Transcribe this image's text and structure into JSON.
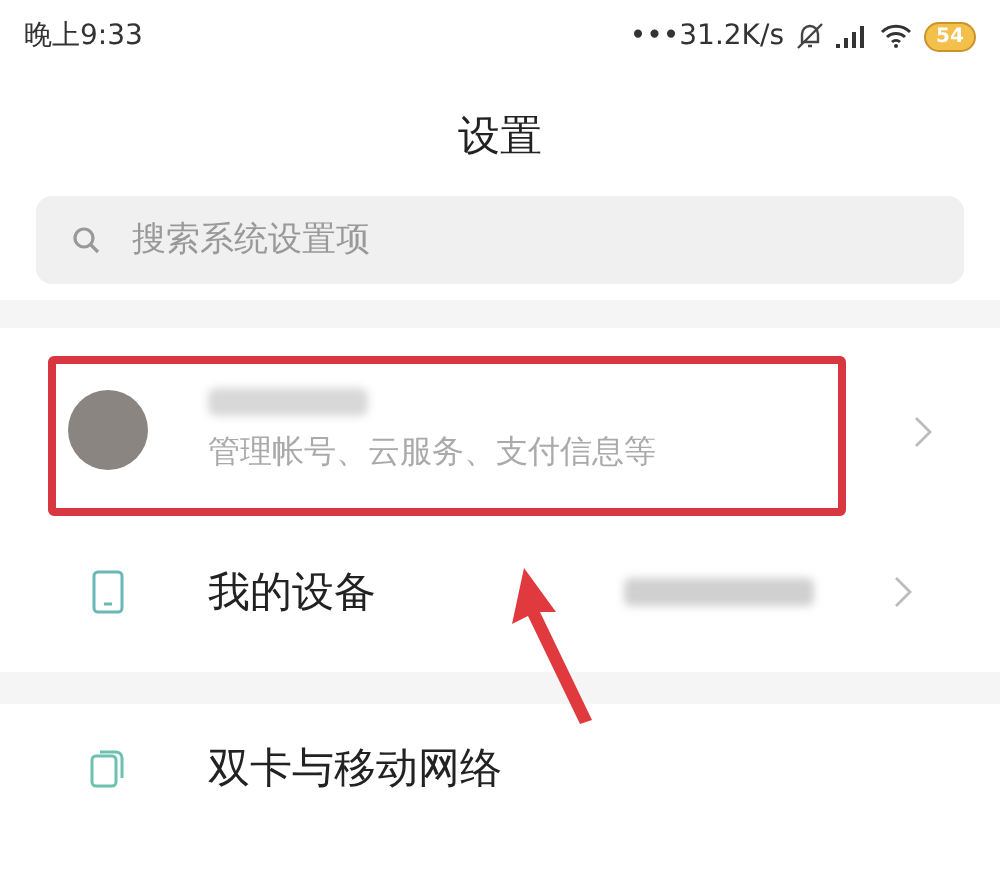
{
  "status_bar": {
    "time": "晚上9:33",
    "net_speed": "•••31.2K/s",
    "battery": "54"
  },
  "title": "设置",
  "search": {
    "placeholder": "搜索系统设置项"
  },
  "account": {
    "subtitle": "管理帐号、云服务、支付信息等",
    "highlighted": true
  },
  "items": [
    {
      "kind": "device",
      "label": "我的设备"
    },
    {
      "kind": "sim",
      "label": "双卡与移动网络"
    }
  ]
}
